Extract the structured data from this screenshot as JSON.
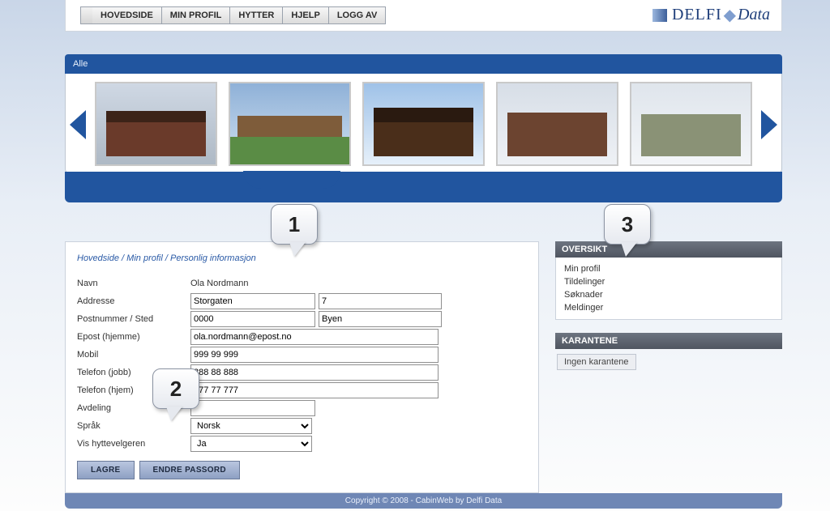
{
  "nav": {
    "items": [
      "HOVEDSIDE",
      "MIN PROFIL",
      "HYTTER",
      "HJELP",
      "LOGG AV"
    ]
  },
  "logo": {
    "brand_a": "DELFI",
    "brand_b": "Data"
  },
  "tabs": {
    "active": "Alle"
  },
  "carousel": {
    "items": [
      {
        "name": "cabin-1"
      },
      {
        "name": "cabin-2"
      },
      {
        "name": "cabin-3"
      },
      {
        "name": "cabin-4"
      },
      {
        "name": "cabin-5"
      }
    ]
  },
  "breadcrumb": {
    "a": "Hovedside",
    "b": "Min profil",
    "c": "Personlig informasjon",
    "sep": " / "
  },
  "form": {
    "name_label": "Navn",
    "name_value": "Ola Nordmann",
    "address_label": "Addresse",
    "address_street": "Storgaten",
    "address_no": "7",
    "zipcity_label": "Postnummer / Sted",
    "zip": "0000",
    "city": "Byen",
    "email_label": "Epost (hjemme)",
    "email": "ola.nordmann@epost.no",
    "mobile_label": "Mobil",
    "mobile": "999 99 999",
    "phone_work_label": "Telefon (jobb)",
    "phone_work": "888 88 888",
    "phone_home_label": "Telefon (hjem)",
    "phone_home": "777 77 777",
    "dept_label": "Avdeling",
    "dept": "",
    "lang_label": "Språk",
    "lang": "Norsk",
    "show_picker_label": "Vis hyttevelgeren",
    "show_picker": "Ja",
    "save": "LAGRE",
    "change_pw": "ENDRE PASSORD"
  },
  "side": {
    "overview_hdr": "OVERSIKT",
    "overview_items": [
      "Min profil",
      "Tildelinger",
      "Søknader",
      "Meldinger"
    ],
    "quarantine_hdr": "KARANTENE",
    "quarantine_text": "Ingen karantene"
  },
  "footer": "Copyright © 2008 - CabinWeb by Delfi Data",
  "callouts": {
    "c1": "1",
    "c2": "2",
    "c3": "3"
  }
}
